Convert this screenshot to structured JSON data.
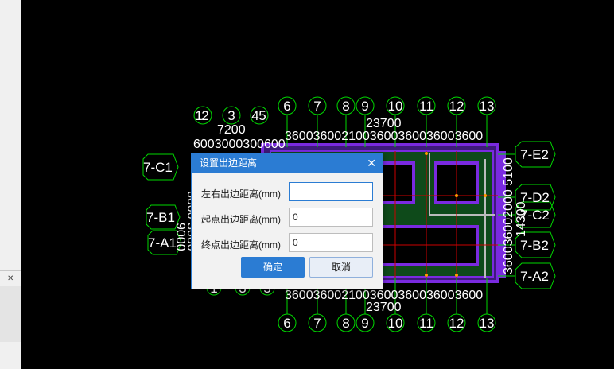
{
  "dialog": {
    "title": "设置出边距离",
    "close_icon": "close-icon",
    "fields": [
      {
        "label": "左右出边距离(mm)",
        "value": ""
      },
      {
        "label": "起点出边距离(mm)",
        "value": "0"
      },
      {
        "label": "终点出边距离(mm)",
        "value": "0"
      }
    ],
    "ok_label": "确定",
    "cancel_label": "取消"
  },
  "drawing": {
    "top_axes": [
      "1",
      "2",
      "3",
      "4",
      "5",
      "6",
      "7",
      "8",
      "9",
      "10",
      "11",
      "12",
      "13"
    ],
    "bottom_axes": [
      "6",
      "7",
      "8",
      "9",
      "10",
      "11",
      "12",
      "13"
    ],
    "bottom_left_axes": [
      "1",
      "3",
      "5"
    ],
    "right_axes": [
      "7-E2",
      "7-D2",
      "7-C2",
      "7-B2",
      "7-A2"
    ],
    "left_axes": [
      "7-C1",
      "7-B1",
      "7-A1"
    ],
    "top_total": "23700",
    "bottom_total": "23700",
    "top_left_dim": "7200",
    "top_left_subdims": "6003000300600",
    "top_dims_row": "3600360021003600360036003600",
    "bottom_dims_row": "3600360021003600360036003600",
    "left_dims": "9000",
    "left_dims2": "6000 3000",
    "right_dims": "360036002000 5100",
    "right_total": "14300"
  },
  "colors": {
    "accent": "#2b7cd3",
    "axis": "#00d800",
    "slab": "#7a2ae0",
    "beam": "#cc0000"
  }
}
